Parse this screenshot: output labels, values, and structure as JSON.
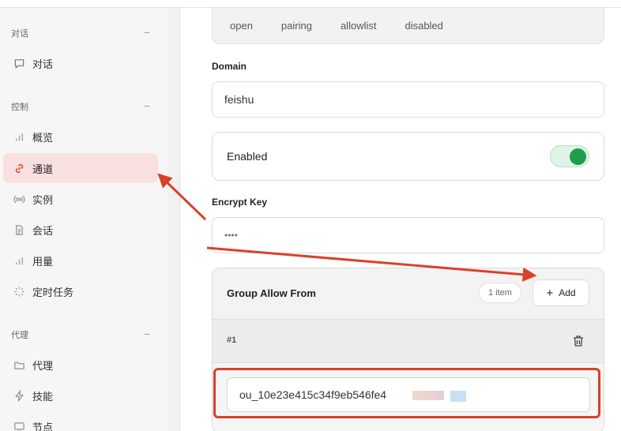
{
  "sidebar": {
    "sections": [
      {
        "title": "对话",
        "items": [
          {
            "label": "对话",
            "icon": "chat-icon"
          }
        ]
      },
      {
        "title": "控制",
        "items": [
          {
            "label": "概览",
            "icon": "bar-chart-icon"
          },
          {
            "label": "通道",
            "icon": "link-icon",
            "active": true
          },
          {
            "label": "实例",
            "icon": "broadcast-icon"
          },
          {
            "label": "会话",
            "icon": "document-icon"
          },
          {
            "label": "用量",
            "icon": "bar-chart-icon"
          },
          {
            "label": "定时任务",
            "icon": "loader-icon"
          }
        ]
      },
      {
        "title": "代理",
        "items": [
          {
            "label": "代理",
            "icon": "folder-icon"
          },
          {
            "label": "技能",
            "icon": "lightning-icon"
          },
          {
            "label": "节点",
            "icon": "monitor-icon"
          }
        ]
      }
    ]
  },
  "policy_options": [
    "open",
    "pairing",
    "allowlist",
    "disabled"
  ],
  "domain": {
    "label": "Domain",
    "value": "feishu"
  },
  "enabled": {
    "label": "Enabled",
    "on": true
  },
  "encrypt_key": {
    "label": "Encrypt Key",
    "value": "••••"
  },
  "group_allow_from": {
    "title": "Group Allow From",
    "count_badge": "1 item",
    "add_label": "Add",
    "items": [
      {
        "index_label": "#1",
        "value": "ou_10e23e415c34f9eb546fe4"
      }
    ]
  },
  "colors": {
    "accent": "#d9412a",
    "active_bg": "#f9e0e0",
    "toggle_on": "#1f9d4c"
  }
}
